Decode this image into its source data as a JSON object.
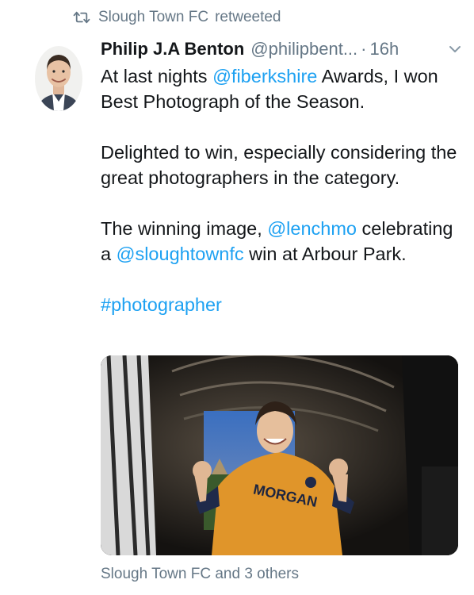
{
  "retweet_context": {
    "icon": "retweet-icon",
    "account": "Slough Town FC",
    "action": "retweeted"
  },
  "tweet": {
    "author_name": "Philip J.A Benton",
    "author_handle": "@philipbent...",
    "separator": "·",
    "timestamp": "16h",
    "menu_icon": "chevron-down-icon",
    "body": {
      "p1_prefix": "At last nights ",
      "p1_mention": "@fiberkshire",
      "p1_suffix": " Awards, I won Best Photograph of the Season.",
      "p2": "Delighted to win, especially considering the great photographers in the category.",
      "p3_prefix": "The winning image, ",
      "p3_mention1": "@lenchmo",
      "p3_middle": " celebrating a ",
      "p3_mention2": "@sloughtownfc",
      "p3_suffix": " win at Arbour Park.",
      "hashtag": "#photographer"
    },
    "media_shirt_text": "MORGAN",
    "engagement": "Slough Town FC and 3 others"
  },
  "colors": {
    "link": "#1da1f2",
    "secondary_text": "#657786",
    "primary_text": "#14171a",
    "shirt": "#e0952a"
  }
}
